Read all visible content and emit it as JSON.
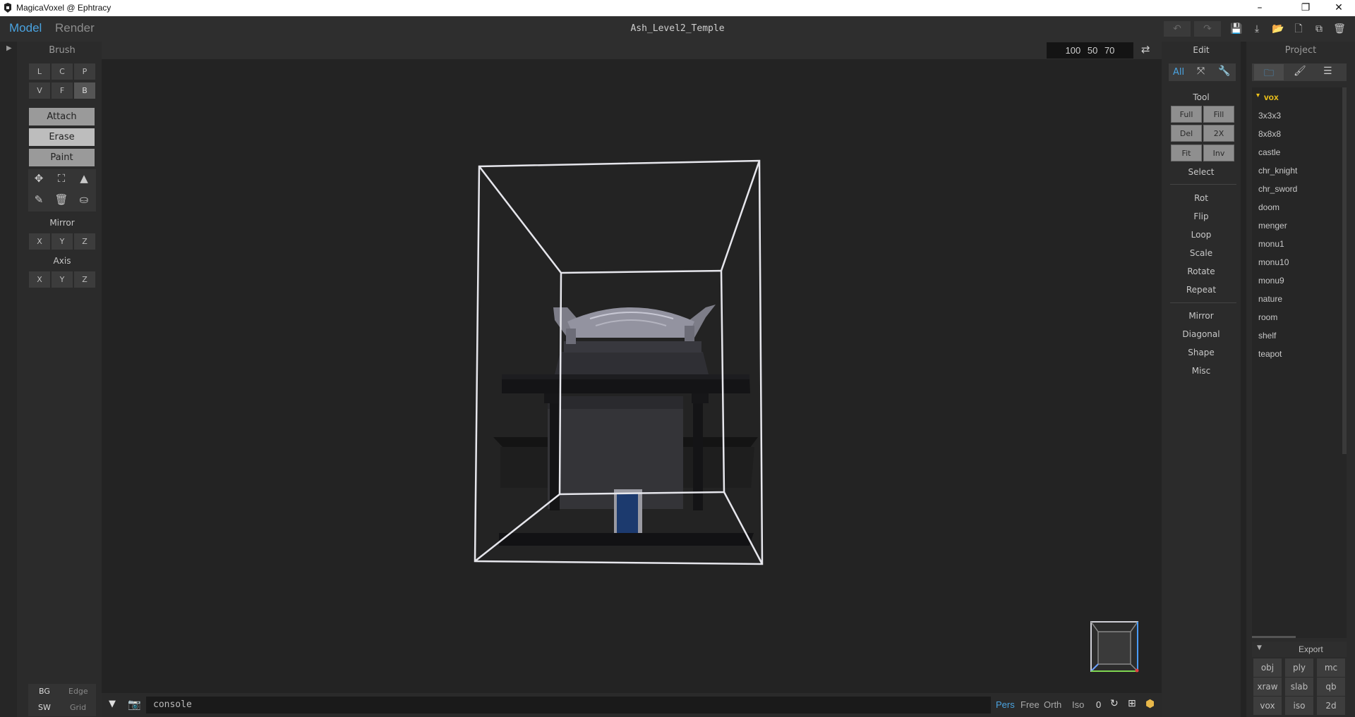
{
  "window": {
    "title": "MagicaVoxel @ Ephtracy",
    "min": "–",
    "max": "❐",
    "close": "✕"
  },
  "header": {
    "tabs": [
      {
        "label": "Model"
      },
      {
        "label": "Render"
      }
    ],
    "project_title": "Ash_Level2_Temple"
  },
  "brush": {
    "title": "Brush",
    "modes_row1": [
      "L",
      "C",
      "P"
    ],
    "modes_row2": [
      "V",
      "F",
      "B"
    ],
    "actions": [
      "Attach",
      "Erase",
      "Paint"
    ],
    "mirror_title": "Mirror",
    "mirror": [
      "X",
      "Y",
      "Z"
    ],
    "axis_title": "Axis",
    "axis": [
      "X",
      "Y",
      "Z"
    ],
    "bottom": {
      "bg": "BG",
      "edge": "Edge",
      "sw": "SW",
      "grid": "Grid"
    }
  },
  "viewport": {
    "dims": "100  50  70",
    "console": "console",
    "view_modes": [
      "Pers",
      "Free",
      "Orth",
      "Iso"
    ],
    "zero": "0"
  },
  "edit": {
    "title": "Edit",
    "all": "All",
    "tool_title": "Tool",
    "tool_buttons": [
      [
        "Full",
        "Fill"
      ],
      [
        "Del",
        "2X"
      ],
      [
        "Fit",
        "Inv"
      ]
    ],
    "select": "Select",
    "group1": [
      "Rot",
      "Flip",
      "Loop",
      "Scale",
      "Rotate",
      "Repeat"
    ],
    "group2": [
      "Mirror",
      "Diagonal",
      "Shape",
      "Misc"
    ]
  },
  "project": {
    "title": "Project",
    "folder": "vox",
    "files": [
      "3x3x3",
      "8x8x8",
      "castle",
      "chr_knight",
      "chr_sword",
      "doom",
      "menger",
      "monu1",
      "monu10",
      "monu9",
      "nature",
      "room",
      "shelf",
      "teapot"
    ],
    "export_title": "Export",
    "export": [
      [
        "obj",
        "ply",
        "mc"
      ],
      [
        "xraw",
        "slab",
        "qb"
      ],
      [
        "vox",
        "iso",
        "2d"
      ]
    ]
  },
  "colors": {
    "accent": "#4aa3e0",
    "folder": "#f0c419",
    "door": "#1c3a6e"
  }
}
